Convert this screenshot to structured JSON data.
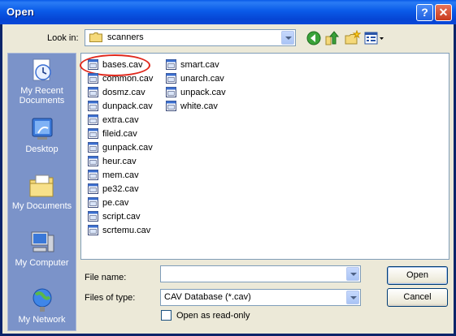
{
  "window": {
    "title": "Open"
  },
  "titlebar": {
    "help_glyph": "?",
    "close_glyph": "✕"
  },
  "toolbar": {
    "lookin_label": "Look in:",
    "lookin_value": "scanners",
    "icons": [
      "back-icon",
      "up-folder-icon",
      "new-folder-icon",
      "view-menu-icon"
    ]
  },
  "places": [
    {
      "label": "My Recent Documents",
      "icon": "recent-documents-icon"
    },
    {
      "label": "Desktop",
      "icon": "desktop-icon"
    },
    {
      "label": "My Documents",
      "icon": "my-documents-icon"
    },
    {
      "label": "My Computer",
      "icon": "my-computer-icon"
    },
    {
      "label": "My Network",
      "icon": "my-network-icon"
    }
  ],
  "files": {
    "column1": [
      "bases.cav",
      "common.cav",
      "dosmz.cav",
      "dunpack.cav",
      "extra.cav",
      "fileid.cav",
      "gunpack.cav",
      "heur.cav",
      "mem.cav",
      "pe32.cav",
      "pe.cav",
      "script.cav",
      "scrtemu.cav"
    ],
    "column2": [
      "smart.cav",
      "unarch.cav",
      "unpack.cav",
      "white.cav"
    ],
    "highlighted": "bases.cav"
  },
  "form": {
    "filename_label": "File name:",
    "filename_value": "",
    "filetype_label": "Files of type:",
    "filetype_value": "CAV Database (*.cav)",
    "readonly_label": "Open as read-only",
    "readonly_checked": false
  },
  "buttons": {
    "open": "Open",
    "cancel": "Cancel"
  },
  "colors": {
    "title_bar": "#0a5ae8",
    "places_bar": "#7b93c9",
    "annotation_circle": "#e0281c"
  }
}
